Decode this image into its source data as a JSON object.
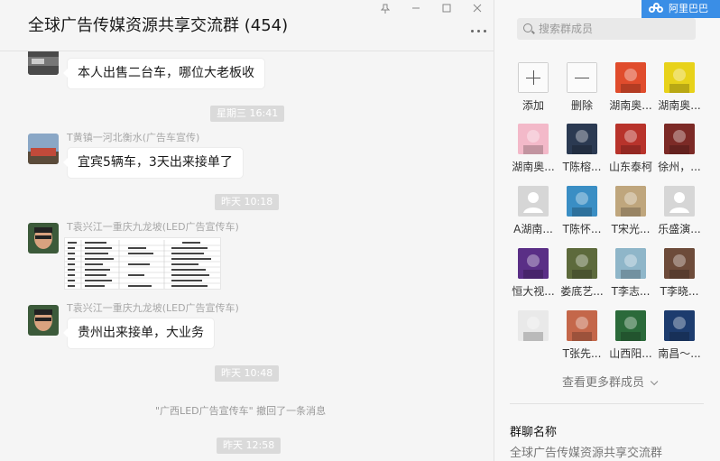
{
  "header": {
    "title": "全球广告传媒资源共享交流群 (454)"
  },
  "window_controls": {
    "pin_icon": "pin-icon",
    "minimize_icon": "minimize-icon",
    "maximize_icon": "maximize-icon",
    "close_icon": "close-icon"
  },
  "chat": {
    "messages": [
      {
        "text": "本人出售二台车，哪位大老板收"
      },
      {
        "time": "星期三 16:41"
      },
      {
        "sender": "T黄镇一河北衡水(广告车宣传)",
        "text": "宜宾5辆车，3天出来接单了"
      },
      {
        "time": "昨天 10:18"
      },
      {
        "sender": "T袁兴江一重庆九龙坡(LED广告宣传车)",
        "image": "spreadsheet-screenshot"
      },
      {
        "sender": "T袁兴江一重庆九龙坡(LED广告宣传车)",
        "text": "贵州出来接单，大业务"
      },
      {
        "time": "昨天 10:48"
      },
      {
        "system": "\"广西LED广告宣传车\" 撤回了一条消息"
      },
      {
        "time": "昨天 12:58"
      }
    ]
  },
  "panel": {
    "brand_badge": "阿里巴巴",
    "search_placeholder": "搜索群成员",
    "members": [
      {
        "name": "添加",
        "kind": "add"
      },
      {
        "name": "删除",
        "kind": "remove"
      },
      {
        "name": "湖南奥...",
        "kind": "avatar",
        "color": "#e04c2c"
      },
      {
        "name": "湖南奥...",
        "kind": "avatar",
        "color": "#e8d21a"
      },
      {
        "name": "湖南奥...",
        "kind": "avatar",
        "color": "#f3b9c9"
      },
      {
        "name": "T陈榕...",
        "kind": "avatar",
        "color": "#2b3a52"
      },
      {
        "name": "山东泰柯",
        "kind": "avatar",
        "color": "#b8332b"
      },
      {
        "name": "徐州，...",
        "kind": "avatar",
        "color": "#7c2a26"
      },
      {
        "name": "A湖南...",
        "kind": "avatar",
        "color": "#d6d6d6"
      },
      {
        "name": "T陈怀...",
        "kind": "avatar",
        "color": "#3a8ec4"
      },
      {
        "name": "T宋光...",
        "kind": "avatar",
        "color": "#bfa67d"
      },
      {
        "name": "乐盛演...",
        "kind": "avatar",
        "color": "#d6d6d6"
      },
      {
        "name": "恒大视...",
        "kind": "avatar",
        "color": "#5a2f86"
      },
      {
        "name": "娄底艺...",
        "kind": "avatar",
        "color": "#5d6a3c"
      },
      {
        "name": "T李志...",
        "kind": "avatar",
        "color": "#8fb6c9"
      },
      {
        "name": "T李晓...",
        "kind": "avatar",
        "color": "#6d4b3a"
      },
      {
        "name": "",
        "kind": "avatar",
        "color": "#e9e9e9"
      },
      {
        "name": "T张先...",
        "kind": "avatar",
        "color": "#c4674a"
      },
      {
        "name": "山西阳...",
        "kind": "avatar",
        "color": "#2b6a3a"
      },
      {
        "name": "南昌～...",
        "kind": "avatar",
        "color": "#1d3c6e"
      }
    ],
    "see_more": "查看更多群成员",
    "group_name_label": "群聊名称",
    "group_name_value": "全球广告传媒资源共享交流群"
  }
}
